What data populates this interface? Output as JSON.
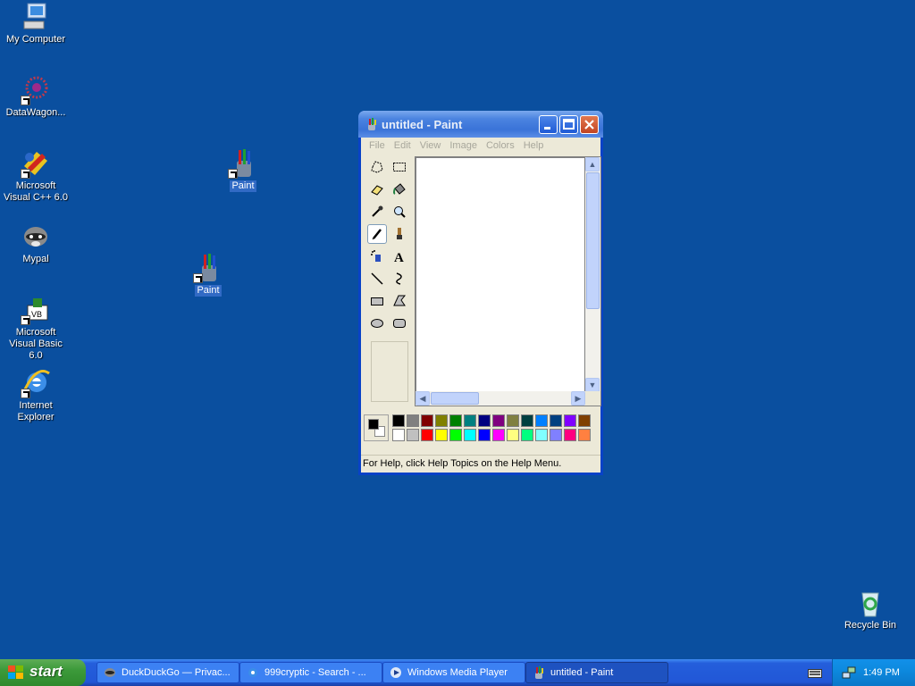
{
  "desktop": {
    "icons": [
      {
        "label": "My Computer"
      },
      {
        "label": "DataWagon..."
      },
      {
        "label": "Microsoft Visual C++ 6.0"
      },
      {
        "label": "Mypal"
      },
      {
        "label": "Microsoft Visual Basic 6.0"
      },
      {
        "label": "Internet Explorer"
      },
      {
        "label": "Paint"
      },
      {
        "label": "Paint"
      },
      {
        "label": "Recycle Bin"
      }
    ]
  },
  "paint": {
    "title": "untitled - Paint",
    "menu": [
      "File",
      "Edit",
      "View",
      "Image",
      "Colors",
      "Help"
    ],
    "status": "For Help, click Help Topics on the Help Menu.",
    "palette_top": [
      "#000000",
      "#808080",
      "#800000",
      "#808000",
      "#008000",
      "#008080",
      "#000080",
      "#800080",
      "#808040",
      "#004040",
      "#0080ff",
      "#004080",
      "#8000ff",
      "#804000"
    ],
    "palette_bottom": [
      "#ffffff",
      "#c0c0c0",
      "#ff0000",
      "#ffff00",
      "#00ff00",
      "#00ffff",
      "#0000ff",
      "#ff00ff",
      "#ffff80",
      "#00ff80",
      "#80ffff",
      "#8080ff",
      "#ff0080",
      "#ff8040"
    ]
  },
  "taskbar": {
    "start_label": "start",
    "tasks": [
      {
        "label": "DuckDuckGo — Privac..."
      },
      {
        "label": "999cryptic - Search - ..."
      },
      {
        "label": "Windows Media Player"
      },
      {
        "label": "untitled - Paint"
      }
    ],
    "clock": "1:49 PM"
  }
}
